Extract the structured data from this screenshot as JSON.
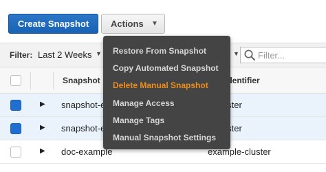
{
  "toolbar": {
    "create_label": "Create Snapshot",
    "actions_label": "Actions"
  },
  "filter": {
    "label": "Filter:",
    "value": "Last 2 Weeks",
    "search_placeholder": "Filter..."
  },
  "table": {
    "headers": {
      "snapshot": "Snapshot",
      "cluster": "Identifier"
    },
    "rows": [
      {
        "name": "snapshot-e",
        "cluster": "e-cluster",
        "selected": true
      },
      {
        "name": "snapshot-e",
        "cluster": "e-cluster",
        "selected": true
      },
      {
        "name": "doc-example",
        "cluster": "example-cluster",
        "selected": false
      }
    ]
  },
  "menu": {
    "items": [
      {
        "label": "Restore From Snapshot"
      },
      {
        "label": "Copy Automated Snapshot"
      },
      {
        "label": "Delete Manual Snapshot",
        "highlighted": true
      },
      {
        "label": "Manage Access"
      },
      {
        "label": "Manage Tags"
      },
      {
        "label": "Manual Snapshot Settings"
      }
    ]
  },
  "colors": {
    "primary": "#1a62b3",
    "menu_bg": "#444444",
    "menu_highlight": "#f08d1a",
    "checkbox_selected": "#1f6fd1"
  }
}
